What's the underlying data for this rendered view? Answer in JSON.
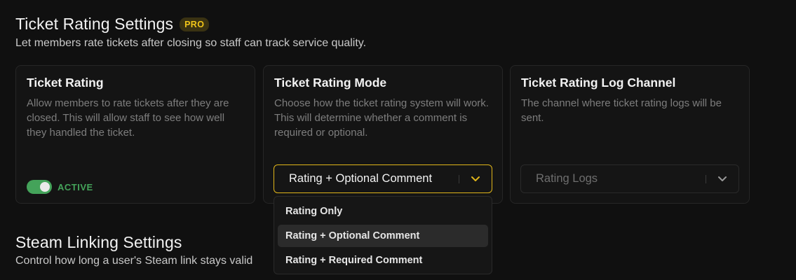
{
  "ticket_rating_section": {
    "title": "Ticket Rating Settings",
    "badge": "PRO",
    "description": "Let members rate tickets after closing so staff can track service quality."
  },
  "cards": {
    "rating": {
      "title": "Ticket Rating",
      "description": "Allow members to rate tickets after they are closed. This will allow staff to see how well they handled the ticket.",
      "toggle_state": "ACTIVE",
      "toggle_on": true
    },
    "mode": {
      "title": "Ticket Rating Mode",
      "description": "Choose how the ticket rating system will work. This will determine whether a comment is required or optional.",
      "selected_value": "Rating + Optional Comment"
    },
    "log_channel": {
      "title": "Ticket Rating Log Channel",
      "description": "The channel where ticket rating logs will be sent.",
      "selected_value": "Rating Logs"
    }
  },
  "mode_dropdown": {
    "options": [
      "Rating Only",
      "Rating + Optional Comment",
      "Rating + Required Comment"
    ],
    "selected_index": 1
  },
  "steam_section": {
    "title": "Steam Linking Settings",
    "description": "Control how long a user's Steam link stays valid"
  },
  "colors": {
    "accent": "#e0b51a",
    "active_green": "#44a35a",
    "background": "#101010"
  },
  "icons": {
    "select_chevron": "chevron-down-icon"
  }
}
